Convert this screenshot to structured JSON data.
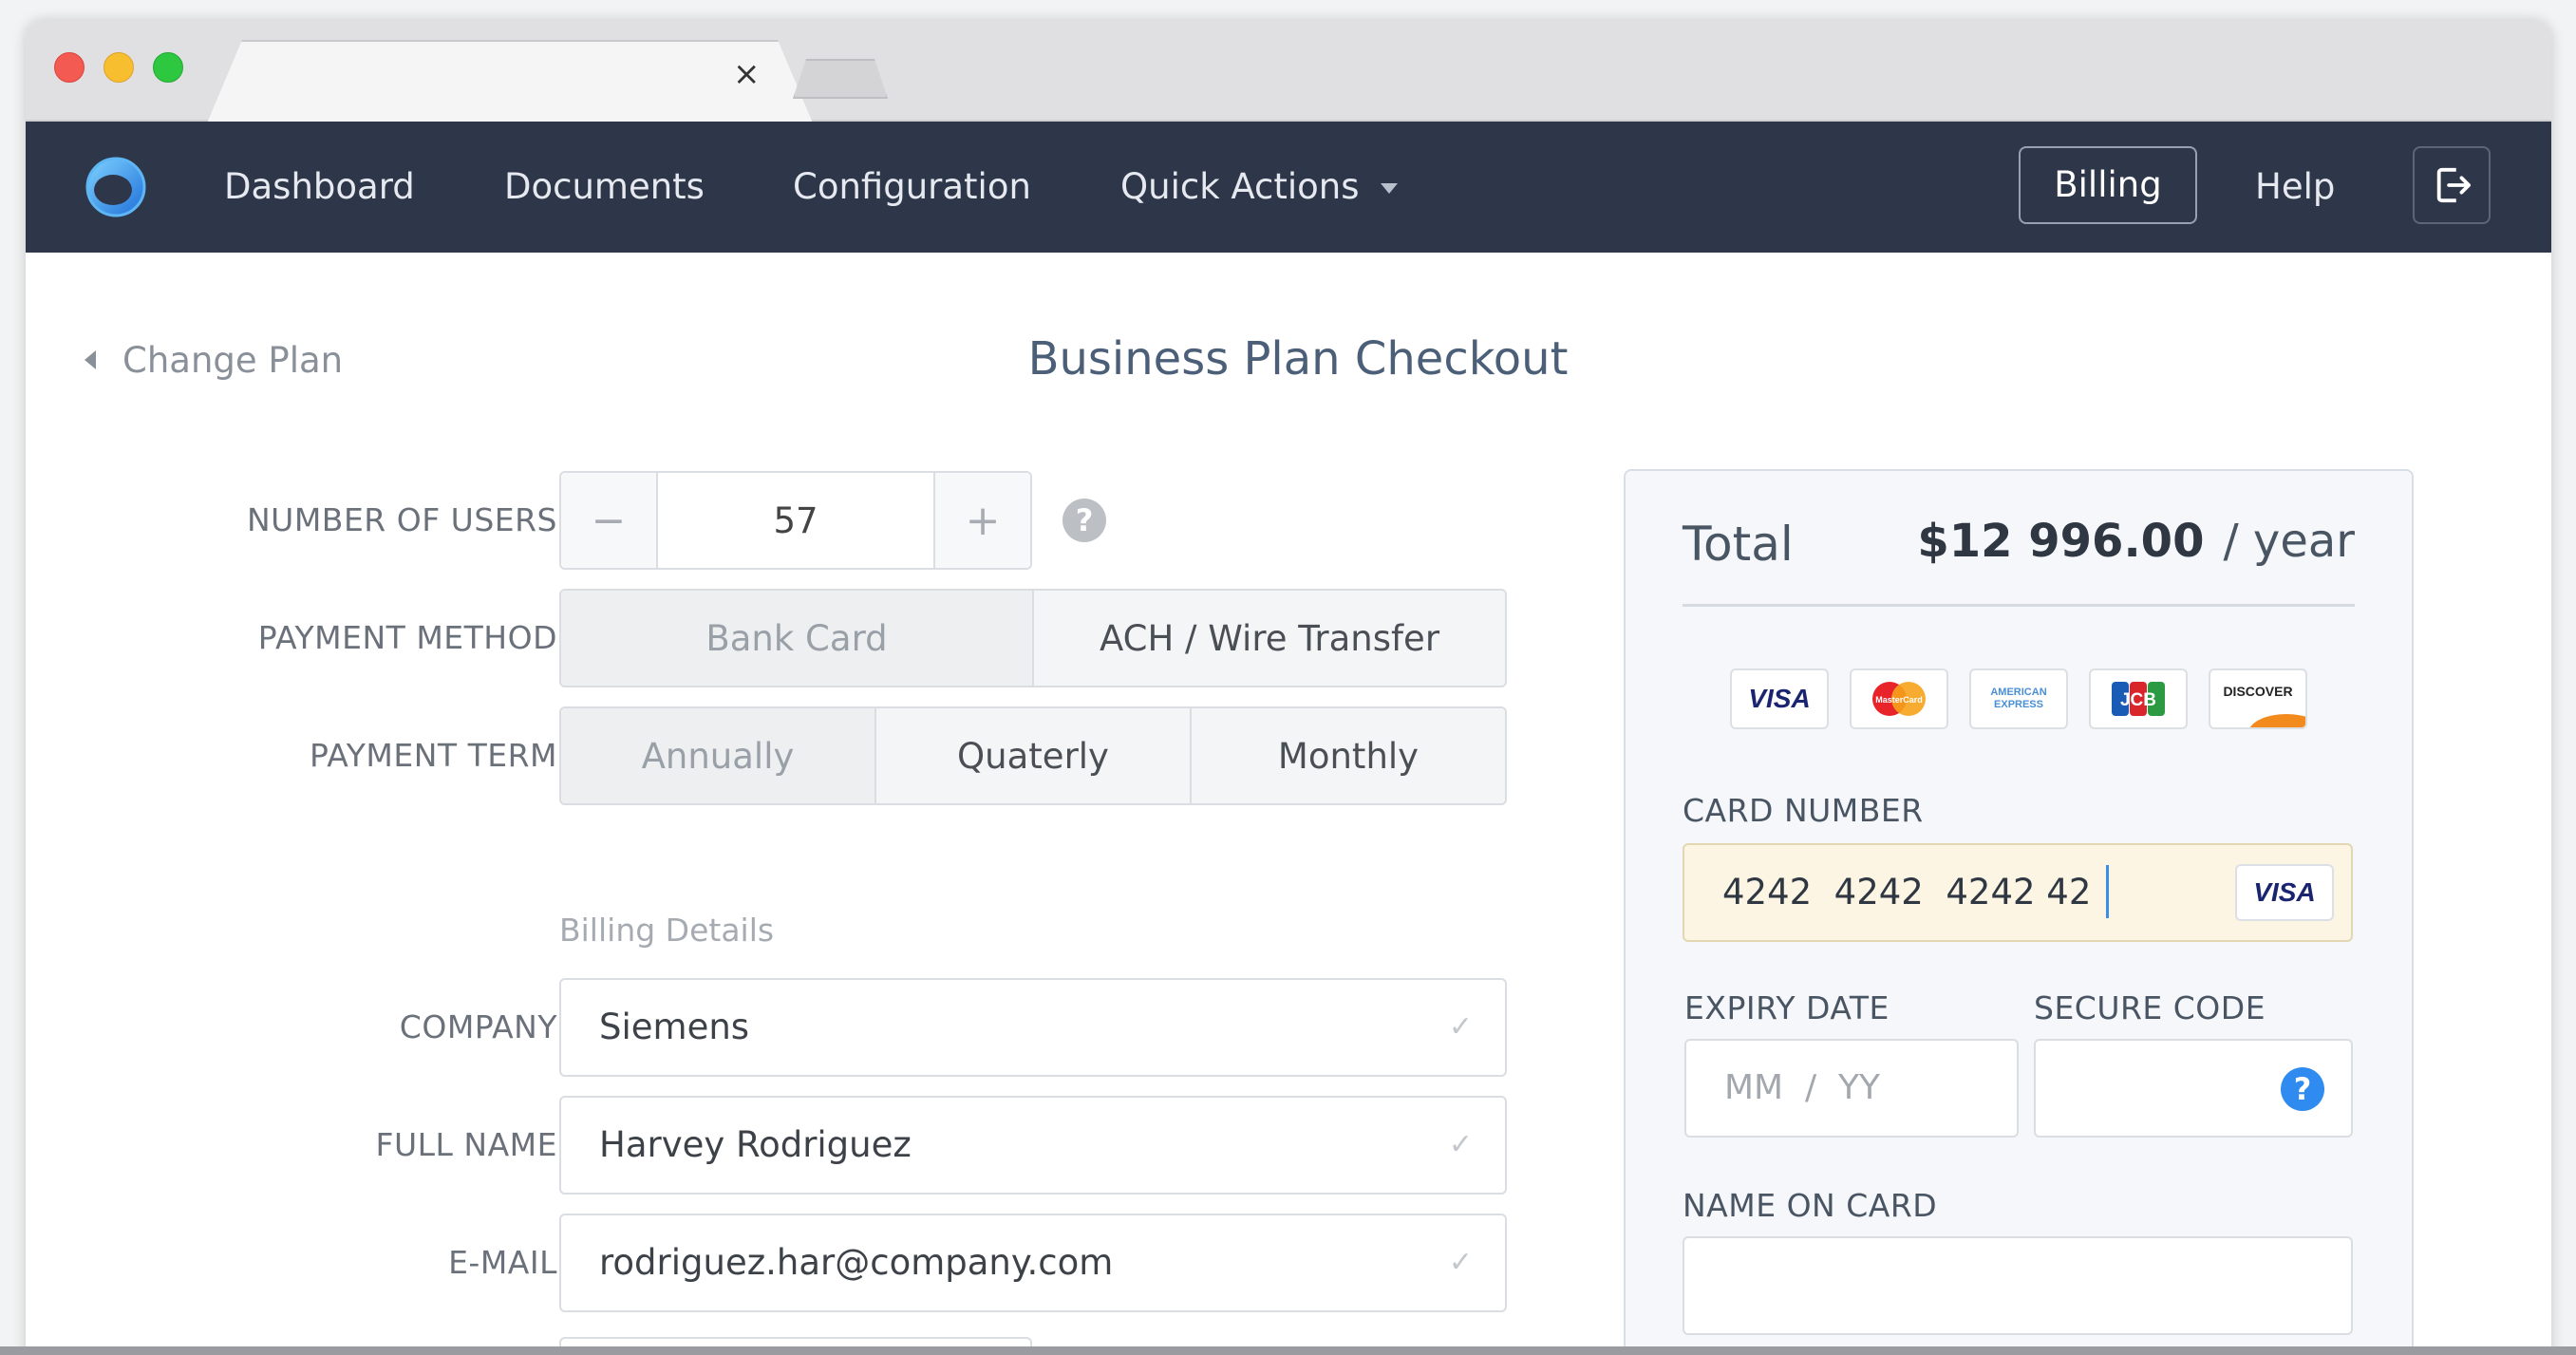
{
  "browser": {
    "tab_close": "×"
  },
  "nav": {
    "items": [
      {
        "label": "Dashboard"
      },
      {
        "label": "Documents"
      },
      {
        "label": "Configuration"
      },
      {
        "label": "Quick Actions"
      }
    ],
    "billing": "Billing",
    "help": "Help"
  },
  "page": {
    "back_label": "Change Plan",
    "title": "Business Plan Checkout"
  },
  "form": {
    "users_label": "NUMBER OF USERS",
    "users_value": "57",
    "minus": "−",
    "plus": "+",
    "help_glyph": "?",
    "payment_method_label": "PAYMENT METHOD",
    "payment_methods": [
      "Bank Card",
      "ACH / Wire Transfer"
    ],
    "payment_term_label": "PAYMENT TERM",
    "payment_terms": [
      "Annually",
      "Quaterly",
      "Monthly"
    ],
    "billing_details_title": "Billing Details",
    "company_label": "COMPANY",
    "company_value": "Siemens",
    "fullname_label": "FULL NAME",
    "fullname_value": "Harvey Rodriguez",
    "email_label": "E-MAIL",
    "email_value": "rodriguez.har@company.com",
    "check_glyph": "✓"
  },
  "summary": {
    "total_label": "Total",
    "total_amount": "$12 996.00",
    "total_unit": "/ year",
    "card_brands": [
      "VISA",
      "MasterCard",
      "AMERICAN EXPRESS",
      "JCB",
      "DISCOVER"
    ],
    "card_number_label": "CARD NUMBER",
    "card_number_value": "4242  4242  4242 42",
    "card_type_badge": "VISA",
    "expiry_label": "EXPIRY DATE",
    "expiry_placeholder": "MM  /  YY",
    "secure_code_label": "SECURE CODE",
    "secure_help": "?",
    "name_on_card_label": "NAME ON CARD"
  },
  "colors": {
    "navbar": "#2e3749",
    "accent_blue": "#2f8bef",
    "title": "#4c5f78",
    "card_input_bg": "#fcf5e3"
  }
}
